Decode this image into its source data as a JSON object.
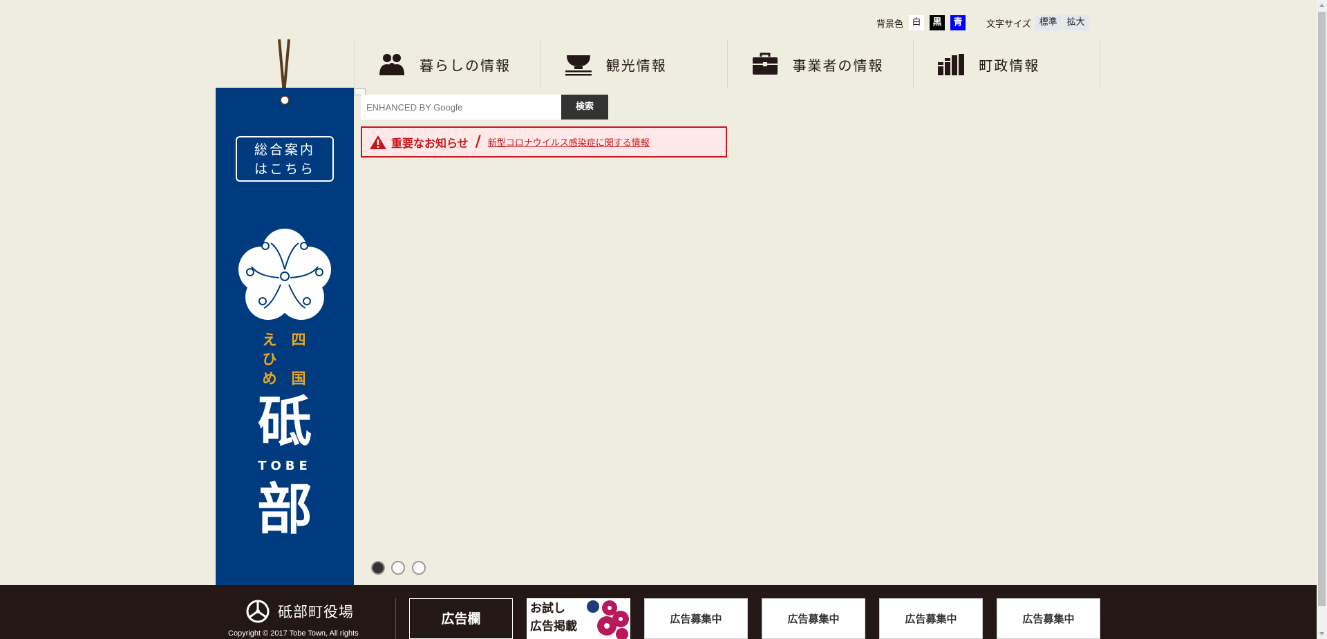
{
  "utility": {
    "bg_label": "背景色",
    "bg_white": "白",
    "bg_black": "黒",
    "bg_blue": "青",
    "fontsize_label": "文字サイズ",
    "fontsize_standard": "標準",
    "fontsize_large": "拡大"
  },
  "nav": {
    "items": [
      {
        "label": "暮らしの情報",
        "icon": "people-icon"
      },
      {
        "label": "観光情報",
        "icon": "bowl-icon"
      },
      {
        "label": "事業者の情報",
        "icon": "briefcase-icon"
      },
      {
        "label": "町政情報",
        "icon": "books-icon"
      }
    ]
  },
  "banner": {
    "guide_line1": "総合案内",
    "guide_line2": "はこちら",
    "ehime": [
      "え",
      "ひ",
      "め"
    ],
    "shikoku": [
      "四",
      "",
      "国"
    ],
    "tobe_kanji_1": "砥",
    "tobe_roman": "TOBE",
    "tobe_kanji_2": "部"
  },
  "search": {
    "placeholder": "ENHANCED BY Google",
    "button": "検索"
  },
  "notice": {
    "title": "重要なお知らせ",
    "slash": "/",
    "link": "新型コロナウイルス感染症に関する情報"
  },
  "slider": {
    "total": 3,
    "active": 1
  },
  "footer": {
    "logo_text": "砥部町役場",
    "copyright": "Copyright © 2017 Tobe Town, All rights",
    "ad_label": "広告欄",
    "ad_trial_line1": "お試し",
    "ad_trial_line2": "広告掲載",
    "ad_slots": [
      "広告募集中",
      "広告募集中",
      "広告募集中",
      "広告募集中"
    ]
  },
  "colors": {
    "page_bg": "#efece0",
    "banner_blue": "#003b80",
    "accent_orange": "#f0a818",
    "notice_red": "#c8161d",
    "footer_dark": "#231815",
    "plum_pink": "#b8185c"
  }
}
